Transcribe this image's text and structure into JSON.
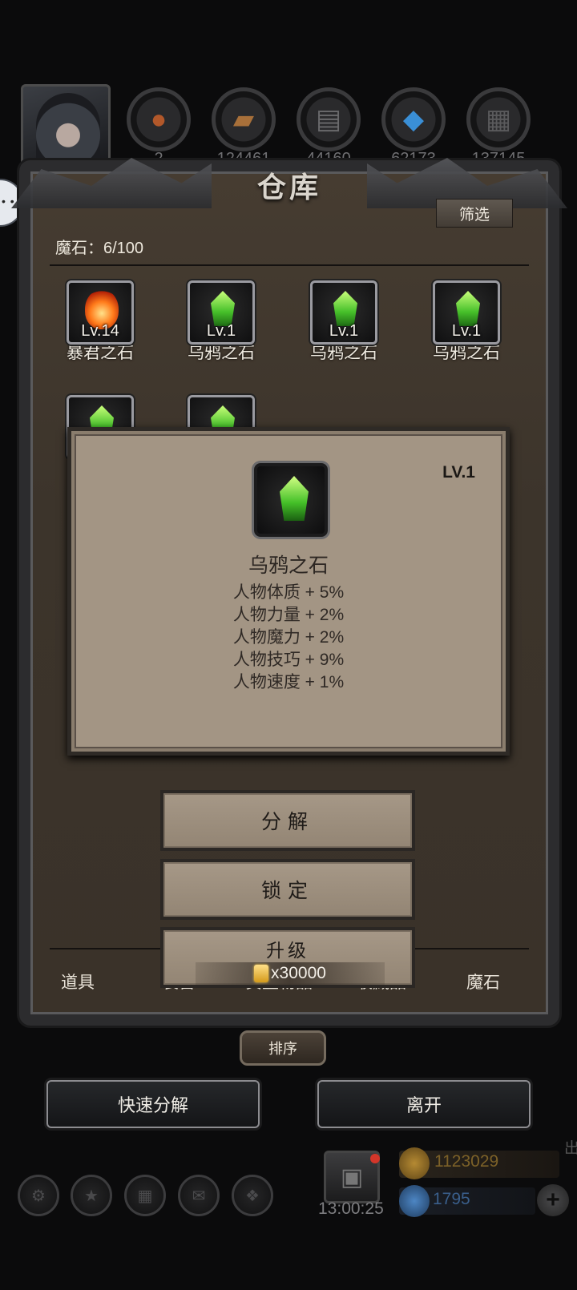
{
  "top_resources": [
    {
      "icon": "gourd-icon",
      "value": "2"
    },
    {
      "icon": "wood-icon",
      "value": "124461"
    },
    {
      "icon": "iron-icon",
      "value": "44160"
    },
    {
      "icon": "crystal-icon",
      "value": "62173"
    },
    {
      "icon": "stone-icon",
      "value": "137145"
    }
  ],
  "panel": {
    "title": "仓库",
    "filter_label": "筛选",
    "stone_count": "魔石：6/100",
    "sort_label": "排序"
  },
  "stones": [
    {
      "name": "暴君之石",
      "level": "Lv.14",
      "icon": "fire-stone-icon"
    },
    {
      "name": "乌鸦之石",
      "level": "Lv.1",
      "icon": "green-stone-icon"
    },
    {
      "name": "乌鸦之石",
      "level": "Lv.1",
      "icon": "green-stone-icon"
    },
    {
      "name": "乌鸦之石",
      "level": "Lv.1",
      "icon": "green-stone-icon"
    }
  ],
  "tabs": [
    "道具",
    "装备",
    "贵重物品",
    "收藏品",
    "魔石"
  ],
  "popup": {
    "level": "LV.1",
    "name": "乌鸦之石",
    "stats": [
      "人物体质 + 5%",
      "人物力量 + 2%",
      "人物魔力 + 2%",
      "人物技巧 + 9%",
      "人物速度 + 1%"
    ]
  },
  "actions": {
    "decompose": "分解",
    "lock": "锁定",
    "upgrade": "升级",
    "upgrade_cost": "x30000"
  },
  "bottom_buttons": {
    "quick_decompose": "快速分解",
    "leave": "离开"
  },
  "status": {
    "timer": "13:00:25",
    "gold": "1123029",
    "gems": "1795",
    "side_text": "出"
  }
}
